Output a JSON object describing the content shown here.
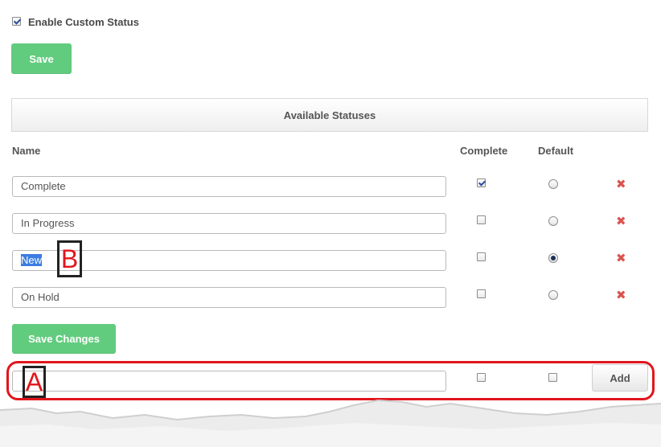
{
  "settings": {
    "enable_custom_status_label": "Enable Custom Status",
    "enable_custom_status_checked": true,
    "save_label": "Save"
  },
  "panel": {
    "title": "Available Statuses"
  },
  "columns": {
    "name": "Name",
    "complete": "Complete",
    "default": "Default"
  },
  "statuses": [
    {
      "name": "Complete",
      "complete": true,
      "default": false
    },
    {
      "name": "In Progress",
      "complete": false,
      "default": false
    },
    {
      "name": "New",
      "complete": false,
      "default": true,
      "selected_text": true
    },
    {
      "name": "On Hold",
      "complete": false,
      "default": false
    }
  ],
  "save_changes_label": "Save Changes",
  "new_status": {
    "value": "",
    "complete": false,
    "default": false,
    "add_label": "Add"
  },
  "annotations": {
    "marker_a": "A",
    "marker_b": "B"
  },
  "colors": {
    "accent_green": "#62cc7e",
    "delete_red": "#d9534f",
    "annotation_red": "#e2161d",
    "selection_blue": "#3b7de0"
  },
  "icons": {
    "delete": "close-icon"
  }
}
